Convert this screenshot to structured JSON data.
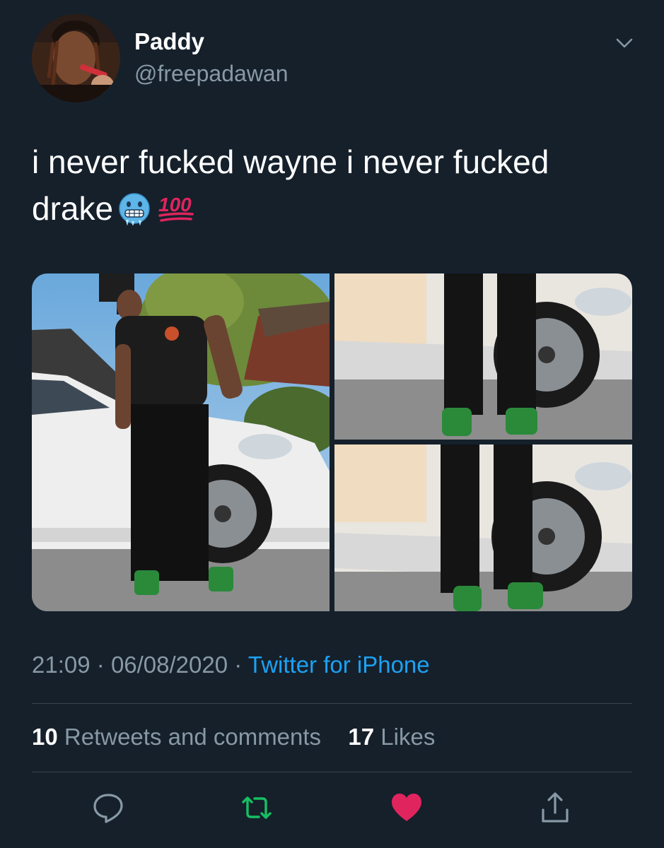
{
  "user": {
    "display_name": "Paddy",
    "handle": "@freepadawan"
  },
  "tweet": {
    "text_line1": "i never fucked wayne i never fucked",
    "text_line2": "drake",
    "emojis": [
      "cold-face-emoji",
      "hundred-points-emoji"
    ],
    "photos": [
      {
        "alt_icon": "photo-man-by-car"
      },
      {
        "alt_icon": "photo-legs-sneakers"
      },
      {
        "alt_icon": "photo-legs-sneakers-2"
      }
    ]
  },
  "meta": {
    "time": "21:09",
    "separator": "·",
    "date": "06/08/2020",
    "source": "Twitter for iPhone"
  },
  "stats": {
    "retweets_count": "10",
    "retweets_label": "Retweets and comments",
    "likes_count": "17",
    "likes_label": "Likes"
  },
  "actions": {
    "icons": [
      "reply-icon",
      "retweet-icon",
      "like-icon",
      "share-icon"
    ]
  },
  "colors": {
    "background": "#15202b",
    "secondary_text": "#8899a6",
    "link": "#1da1f2",
    "retweet_green": "#17bf63",
    "like_red": "#e0245e",
    "divider": "#38444d"
  }
}
